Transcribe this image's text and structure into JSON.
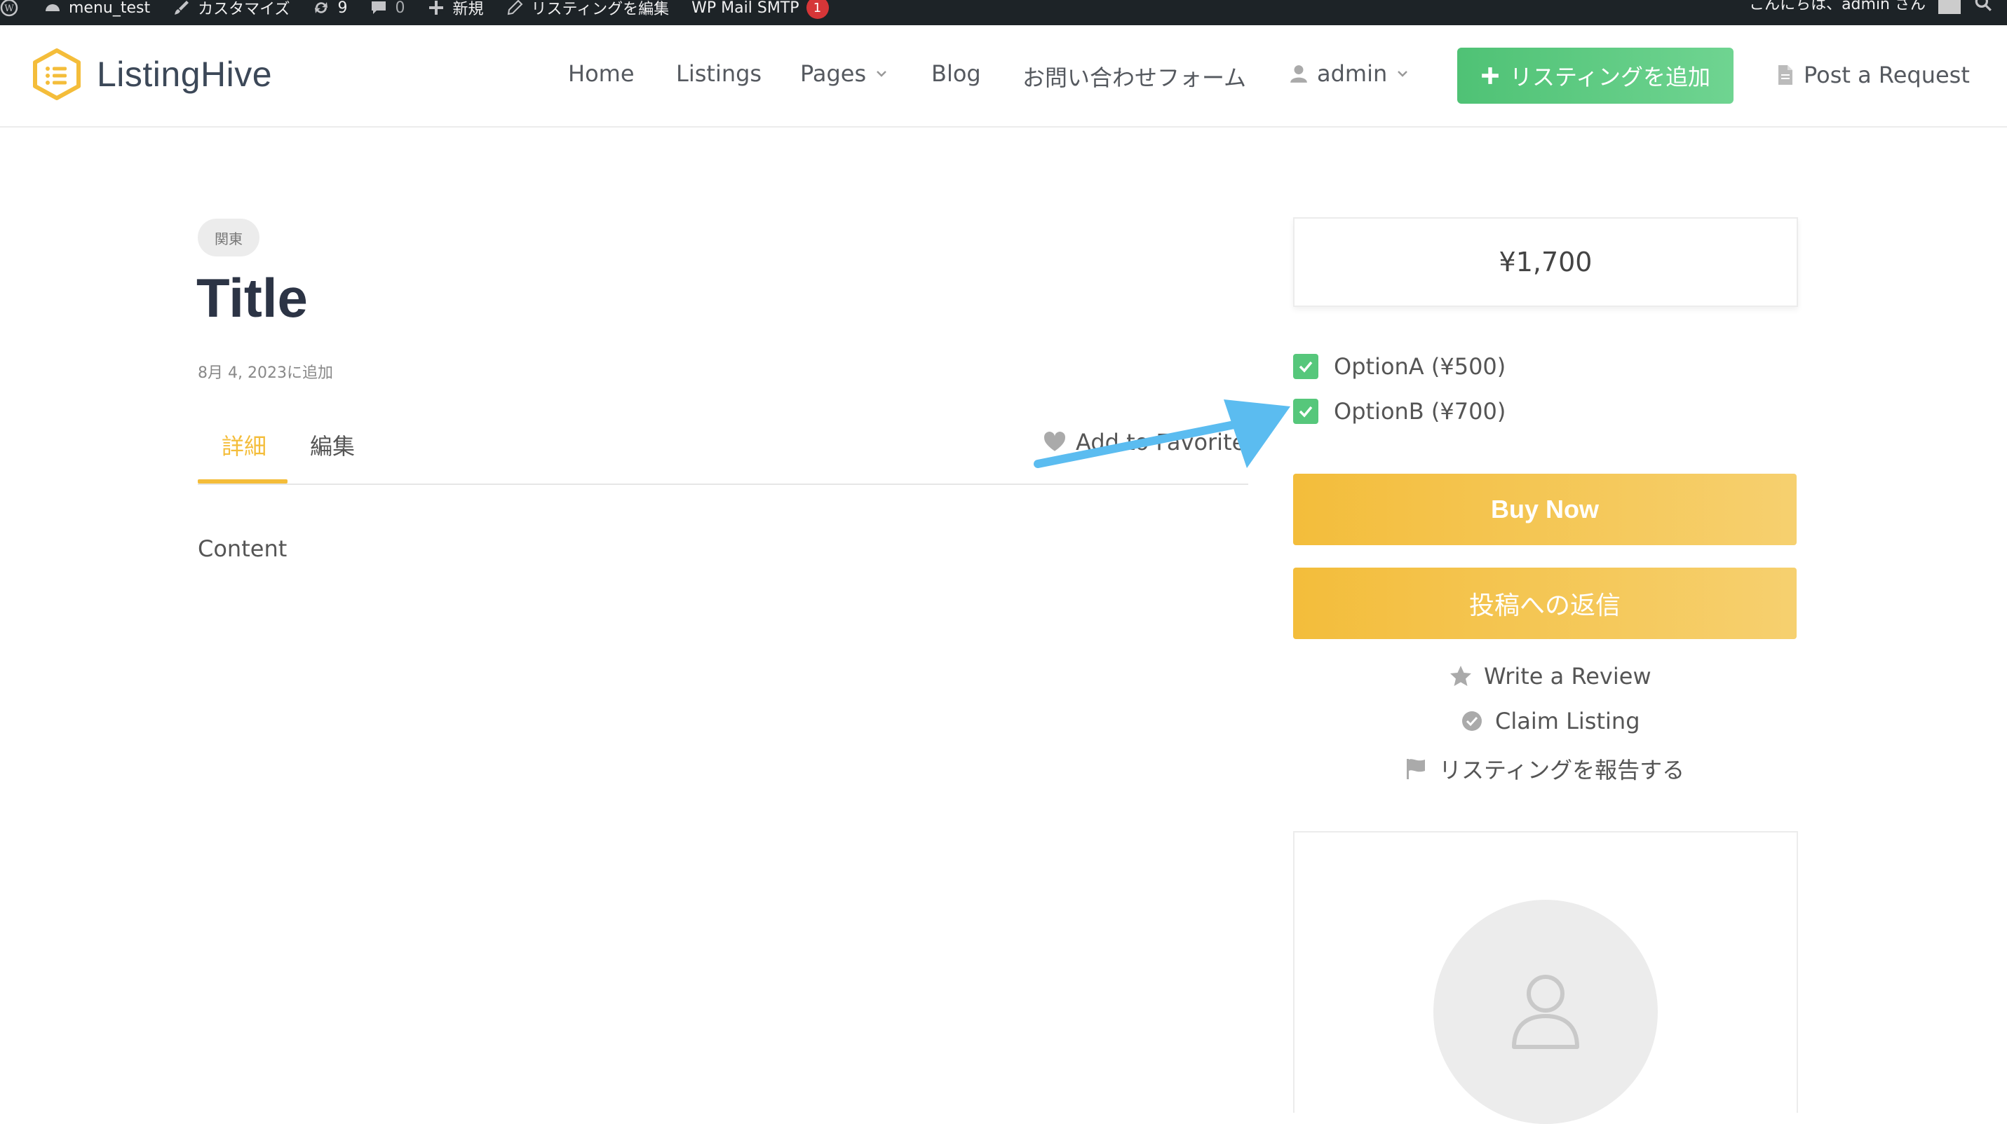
{
  "adminbar": {
    "site_name": "menu_test",
    "customize": "カスタマイズ",
    "updates_count": "9",
    "comments_count": "0",
    "new_label": "新規",
    "edit_listing": "リスティングを編集",
    "smtp_label": "WP Mail SMTP",
    "smtp_badge": "1",
    "greeting": "こんにちは、admin さん"
  },
  "header": {
    "logo_text": "ListingHive",
    "nav": {
      "home": "Home",
      "listings": "Listings",
      "pages": "Pages",
      "blog": "Blog",
      "contact": "お問い合わせフォーム",
      "user": "admin"
    },
    "add_listing_label": "リスティングを追加",
    "post_request_label": "Post a Request"
  },
  "listing": {
    "tag": "関東",
    "title": "Title",
    "date": "8月 4, 2023に追加",
    "tabs": [
      "詳細",
      "編集"
    ],
    "favorites_label": "Add to Favorites",
    "content": "Content"
  },
  "sidebar": {
    "price": "¥1,700",
    "options": [
      {
        "label": "OptionA (¥500)",
        "checked": true
      },
      {
        "label": "OptionB (¥700)",
        "checked": true
      }
    ],
    "buy_now_label": "Buy Now",
    "reply_label": "投稿への返信",
    "links": {
      "review": "Write a Review",
      "claim": "Claim Listing",
      "report": "リスティングを報告する"
    }
  },
  "colors": {
    "accent": "#f4bd3a",
    "green": "#56c77b",
    "arrow": "#5bbcf0"
  }
}
